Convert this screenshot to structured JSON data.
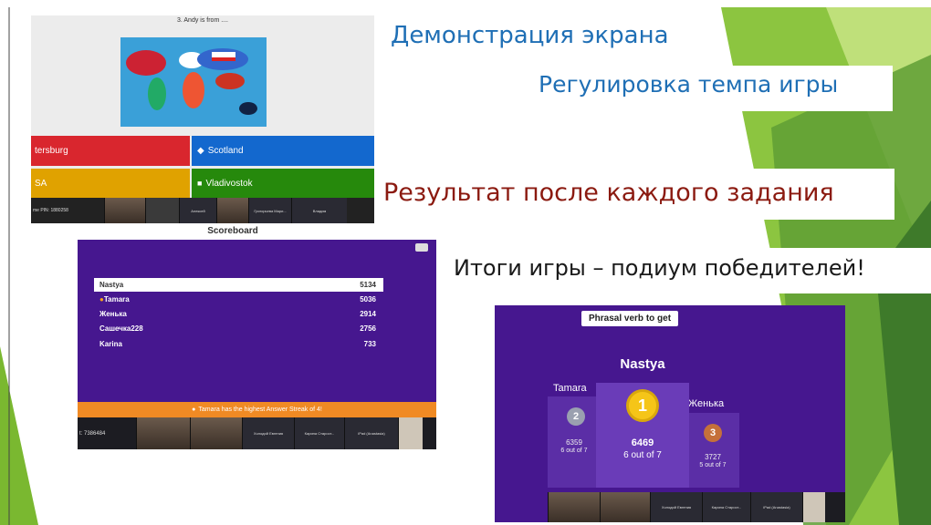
{
  "slide": {
    "title_screen_demo": "Демонстрация экрана",
    "title_pace": "Регулировка темпа игры",
    "title_result": "Результат после каждого задания",
    "title_podium": "Итоги игры – подиум победителей!",
    "colors": {
      "blue_text": "#1f6fb5",
      "red_text": "#8b1a10",
      "green_accent": "#7ab830",
      "dark_green": "#3e7a2a"
    }
  },
  "screen1": {
    "question": "3.  Andy is from ....",
    "answers": [
      {
        "label": "tersburg",
        "color": "#d9262e",
        "icon": "triangle-icon"
      },
      {
        "label": "Scotland",
        "color": "#1368ce",
        "icon": "diamond-icon"
      },
      {
        "label": "SA",
        "color": "#e0a200",
        "icon": "circle-icon"
      },
      {
        "label": "Vladivostok",
        "color": "#26890c",
        "icon": "square-icon"
      }
    ],
    "pin_text": "me PIN: 1880258",
    "video_names": [
      "Алексей",
      "Григорьева Мари...",
      "Владим"
    ]
  },
  "screen2": {
    "title": "Scoreboard",
    "rows": [
      {
        "name": "Nastya",
        "score": "5134"
      },
      {
        "name": "Tamara",
        "score": "5036"
      },
      {
        "name": "Женька",
        "score": "2914"
      },
      {
        "name": "Сашечка228",
        "score": "2756"
      },
      {
        "name": "Karina",
        "score": "733"
      }
    ],
    "streak": "Tamara has the highest Answer Streak of 4!",
    "pin_text": "t: 7386484",
    "video_names": [
      "Холодий Евгения",
      "Карина Старост...",
      "iPad (Anastasia)"
    ]
  },
  "screen3": {
    "title": "Phrasal verb to get",
    "first": {
      "name": "Nastya",
      "place": "1",
      "score": "6469",
      "of": "6 out of 7"
    },
    "second": {
      "name": "Tamara",
      "place": "2",
      "score": "6359",
      "of": "6 out of 7"
    },
    "third": {
      "name": "Женька",
      "place": "3",
      "score": "3727",
      "of": "5 out of 7"
    },
    "video_names": [
      "Холодий Евгения",
      "Карина Старост...",
      "iPad (Anastasia)"
    ]
  }
}
